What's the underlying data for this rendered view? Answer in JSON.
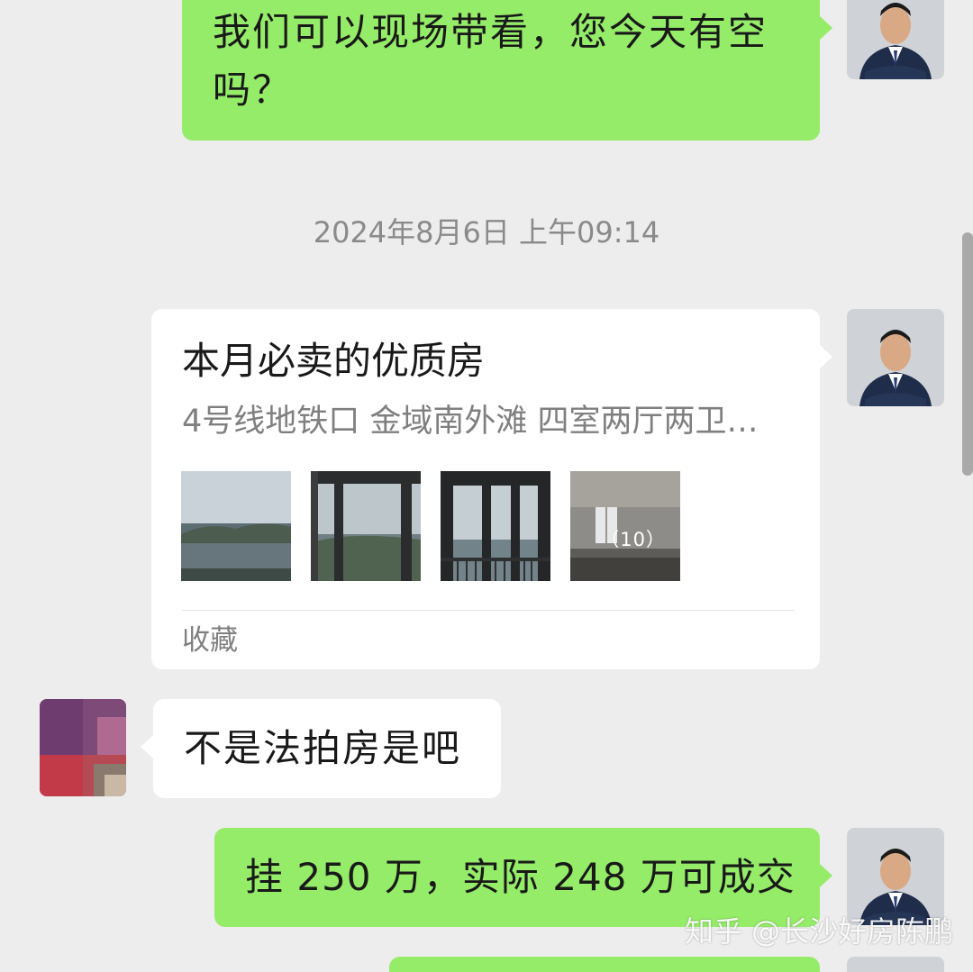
{
  "messages": [
    {
      "side": "right",
      "type": "text",
      "text": "我们可以现场带看，您今天有空吗？"
    },
    {
      "type": "timestamp",
      "text": "2024年8月6日 上午09:14"
    },
    {
      "side": "right",
      "type": "card",
      "title": "本月必卖的优质房",
      "description": "4号线地铁口 金域南外滩 四室两厅两卫…",
      "image_count": "（10）",
      "source": "收藏"
    },
    {
      "side": "left",
      "type": "text",
      "text": "不是法拍房是吧"
    },
    {
      "side": "right",
      "type": "text",
      "text": "挂 250 万，实际 248 万可成交"
    }
  ],
  "watermark": "知乎 @长沙好房陈鹏",
  "colors": {
    "background": "#ededed",
    "outgoing_bubble": "#95ec69",
    "incoming_bubble": "#ffffff",
    "timestamp_text": "#8a8a8a"
  },
  "icons": {
    "agent_avatar": "agent-avatar-icon",
    "customer_avatar": "customer-avatar-icon"
  }
}
